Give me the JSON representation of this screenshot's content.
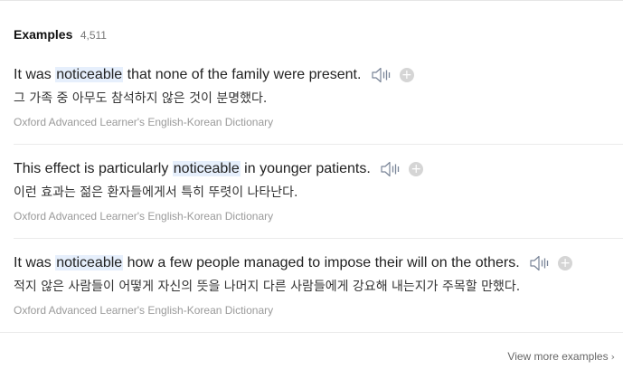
{
  "header": {
    "title": "Examples",
    "count": "4,511"
  },
  "examples": [
    {
      "before": "It was ",
      "highlight": "noticeable",
      "after": " that none of the family were present.",
      "translation": "그 가족 중 아무도 참석하지 않은 것이 분명했다.",
      "source": "Oxford Advanced Learner's English-Korean Dictionary"
    },
    {
      "before": "This effect is particularly ",
      "highlight": "noticeable",
      "after": " in younger patients.",
      "translation": "이런 효과는 젊은 환자들에게서 특히 뚜렷이 나타난다.",
      "source": "Oxford Advanced Learner's English-Korean Dictionary"
    },
    {
      "before": "It was ",
      "highlight": "noticeable",
      "after": " how a few people managed to impose their will on the others.",
      "translation": "적지 않은 사람들이 어떻게 자신의 뜻을 나머지 다른 사람들에게 강요해 내는지가 주목할 만했다.",
      "source": "Oxford Advanced Learner's English-Korean Dictionary"
    }
  ],
  "icons": {
    "audio": "speaker-icon",
    "add": "plus-icon",
    "more": "chevron-right-icon"
  },
  "plus_glyph": "+",
  "chevron_glyph": "›",
  "footer": {
    "more_label": "View more examples"
  },
  "colors": {
    "highlight": "#e6effc",
    "source_text": "#9a9a9a",
    "plus_bg": "#d5d5d5"
  }
}
